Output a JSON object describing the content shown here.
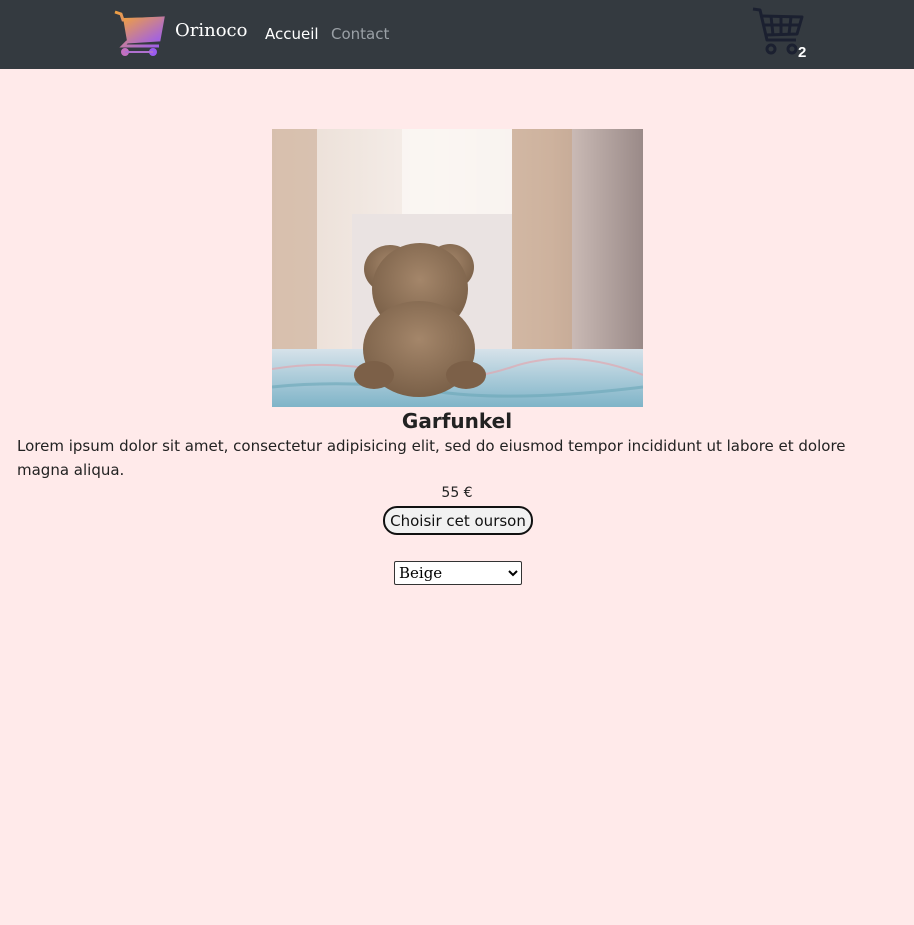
{
  "brand": {
    "name": "Orinoco",
    "icon": "shopping-cart-gradient-icon"
  },
  "nav": {
    "home": "Accueil",
    "contact": "Contact"
  },
  "cart": {
    "icon": "shopping-cart-icon",
    "count": "2"
  },
  "product": {
    "image_icon": "teddy-bear-photo",
    "name": "Garfunkel",
    "description": "Lorem ipsum dolor sit amet, consectetur adipisicing elit, sed do eiusmod tempor incididunt ut labore et dolore magna aliqua.",
    "price": "55 €",
    "choose_label": "Choisir cet ourson",
    "selected_color": "Beige",
    "color_options": [
      "Beige"
    ]
  },
  "colors": {
    "navbar": "#343a40",
    "background": "#ffeaea",
    "nav_inactive": "#9aa0a6",
    "cart_icon": "#1b2030",
    "logo_gradient_start": "#f0a040",
    "logo_gradient_end": "#9b5cf0"
  }
}
